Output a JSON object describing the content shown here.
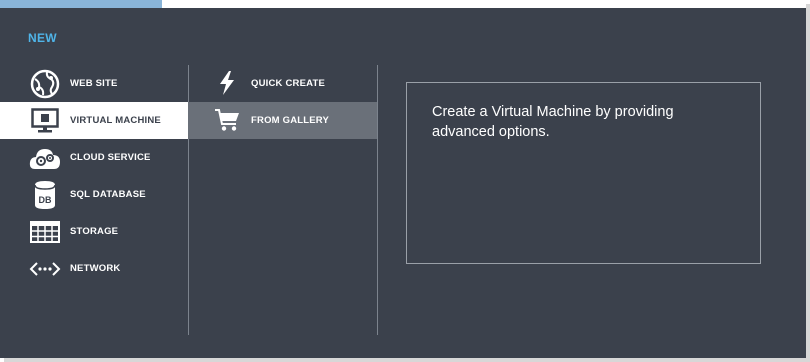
{
  "header": {
    "new_label": "NEW"
  },
  "categories": [
    {
      "label": "WEB SITE",
      "icon": "globe-icon"
    },
    {
      "label": "VIRTUAL MACHINE",
      "icon": "monitor-icon",
      "selected": true
    },
    {
      "label": "CLOUD SERVICE",
      "icon": "cloud-gears-icon"
    },
    {
      "label": "SQL DATABASE",
      "icon": "database-icon"
    },
    {
      "label": "STORAGE",
      "icon": "table-grid-icon"
    },
    {
      "label": "NETWORK",
      "icon": "network-icon"
    }
  ],
  "options": [
    {
      "label": "QUICK CREATE",
      "icon": "lightning-icon"
    },
    {
      "label": "FROM GALLERY",
      "icon": "cart-icon",
      "selected": true
    }
  ],
  "description": {
    "text": "Create a Virtual Machine by providing advanced options."
  },
  "colors": {
    "background": "#3b414c",
    "accent": "#4fb4e8",
    "selected_category_bg": "#ffffff",
    "selected_option_bg": "#6a7079",
    "top_accent_bar": "#89b4d8"
  }
}
